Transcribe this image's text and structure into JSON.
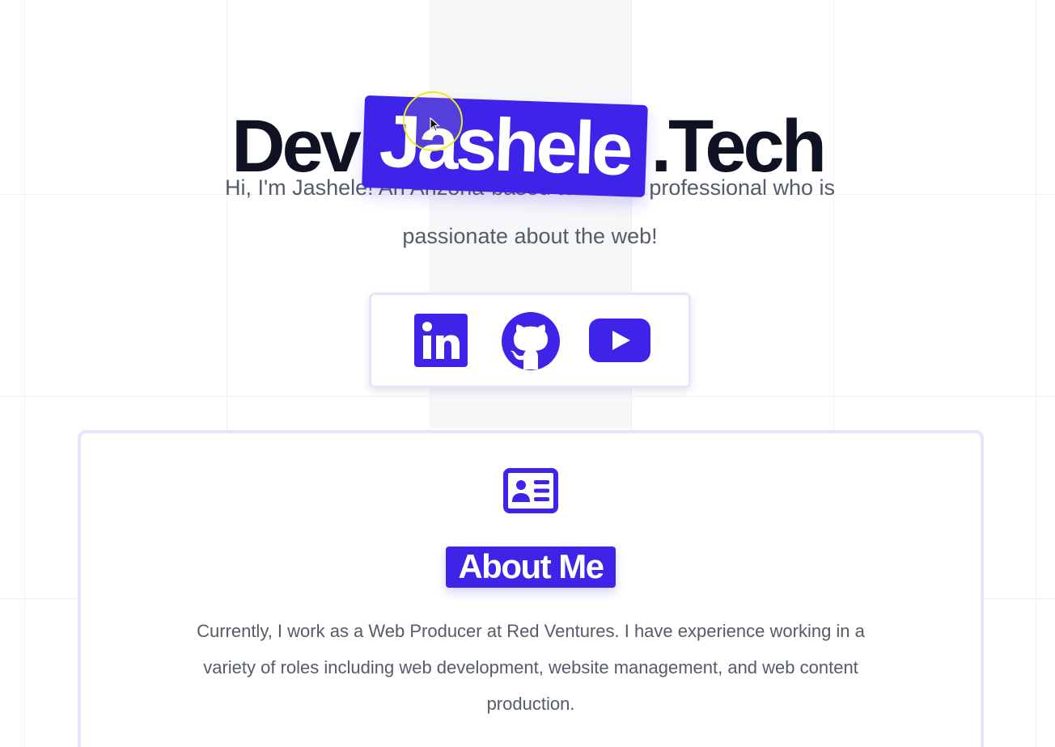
{
  "hero": {
    "title_prefix": "Dev",
    "title_name": "Jashele",
    "title_suffix": ".Tech",
    "intro": "Hi, I'm Jashele! An Arizona-based technical professional who is passionate about the web!"
  },
  "social": {
    "links": [
      {
        "name": "LinkedIn",
        "icon": "linkedin-icon"
      },
      {
        "name": "GitHub",
        "icon": "github-icon"
      },
      {
        "name": "YouTube",
        "icon": "youtube-icon"
      }
    ]
  },
  "about": {
    "icon": "id-card-icon",
    "heading": "About Me",
    "text": "Currently, I work as a Web Producer at Red Ventures. I have experience working in a variety of roles including web development, website management, and web content production."
  },
  "colors": {
    "accent": "#3d24e8",
    "heading_text": "#0f1222",
    "body_text": "#555b69",
    "card_border": "#e3e6fb"
  }
}
